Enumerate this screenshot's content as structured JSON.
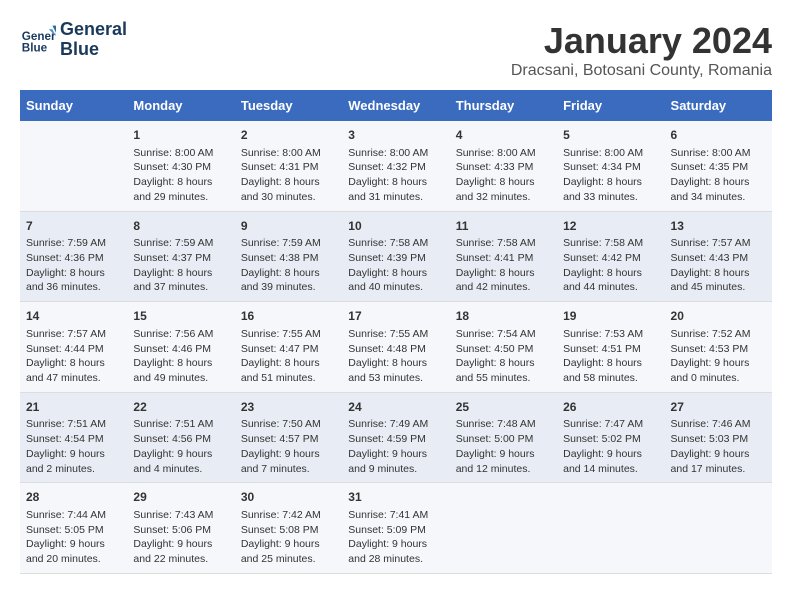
{
  "header": {
    "logo_line1": "General",
    "logo_line2": "Blue",
    "title": "January 2024",
    "subtitle": "Dracsani, Botosani County, Romania"
  },
  "days": [
    "Sunday",
    "Monday",
    "Tuesday",
    "Wednesday",
    "Thursday",
    "Friday",
    "Saturday"
  ],
  "weeks": [
    [
      {
        "date": "",
        "sunrise": "",
        "sunset": "",
        "daylight": ""
      },
      {
        "date": "1",
        "sunrise": "Sunrise: 8:00 AM",
        "sunset": "Sunset: 4:30 PM",
        "daylight": "Daylight: 8 hours and 29 minutes."
      },
      {
        "date": "2",
        "sunrise": "Sunrise: 8:00 AM",
        "sunset": "Sunset: 4:31 PM",
        "daylight": "Daylight: 8 hours and 30 minutes."
      },
      {
        "date": "3",
        "sunrise": "Sunrise: 8:00 AM",
        "sunset": "Sunset: 4:32 PM",
        "daylight": "Daylight: 8 hours and 31 minutes."
      },
      {
        "date": "4",
        "sunrise": "Sunrise: 8:00 AM",
        "sunset": "Sunset: 4:33 PM",
        "daylight": "Daylight: 8 hours and 32 minutes."
      },
      {
        "date": "5",
        "sunrise": "Sunrise: 8:00 AM",
        "sunset": "Sunset: 4:34 PM",
        "daylight": "Daylight: 8 hours and 33 minutes."
      },
      {
        "date": "6",
        "sunrise": "Sunrise: 8:00 AM",
        "sunset": "Sunset: 4:35 PM",
        "daylight": "Daylight: 8 hours and 34 minutes."
      }
    ],
    [
      {
        "date": "7",
        "sunrise": "Sunrise: 7:59 AM",
        "sunset": "Sunset: 4:36 PM",
        "daylight": "Daylight: 8 hours and 36 minutes."
      },
      {
        "date": "8",
        "sunrise": "Sunrise: 7:59 AM",
        "sunset": "Sunset: 4:37 PM",
        "daylight": "Daylight: 8 hours and 37 minutes."
      },
      {
        "date": "9",
        "sunrise": "Sunrise: 7:59 AM",
        "sunset": "Sunset: 4:38 PM",
        "daylight": "Daylight: 8 hours and 39 minutes."
      },
      {
        "date": "10",
        "sunrise": "Sunrise: 7:58 AM",
        "sunset": "Sunset: 4:39 PM",
        "daylight": "Daylight: 8 hours and 40 minutes."
      },
      {
        "date": "11",
        "sunrise": "Sunrise: 7:58 AM",
        "sunset": "Sunset: 4:41 PM",
        "daylight": "Daylight: 8 hours and 42 minutes."
      },
      {
        "date": "12",
        "sunrise": "Sunrise: 7:58 AM",
        "sunset": "Sunset: 4:42 PM",
        "daylight": "Daylight: 8 hours and 44 minutes."
      },
      {
        "date": "13",
        "sunrise": "Sunrise: 7:57 AM",
        "sunset": "Sunset: 4:43 PM",
        "daylight": "Daylight: 8 hours and 45 minutes."
      }
    ],
    [
      {
        "date": "14",
        "sunrise": "Sunrise: 7:57 AM",
        "sunset": "Sunset: 4:44 PM",
        "daylight": "Daylight: 8 hours and 47 minutes."
      },
      {
        "date": "15",
        "sunrise": "Sunrise: 7:56 AM",
        "sunset": "Sunset: 4:46 PM",
        "daylight": "Daylight: 8 hours and 49 minutes."
      },
      {
        "date": "16",
        "sunrise": "Sunrise: 7:55 AM",
        "sunset": "Sunset: 4:47 PM",
        "daylight": "Daylight: 8 hours and 51 minutes."
      },
      {
        "date": "17",
        "sunrise": "Sunrise: 7:55 AM",
        "sunset": "Sunset: 4:48 PM",
        "daylight": "Daylight: 8 hours and 53 minutes."
      },
      {
        "date": "18",
        "sunrise": "Sunrise: 7:54 AM",
        "sunset": "Sunset: 4:50 PM",
        "daylight": "Daylight: 8 hours and 55 minutes."
      },
      {
        "date": "19",
        "sunrise": "Sunrise: 7:53 AM",
        "sunset": "Sunset: 4:51 PM",
        "daylight": "Daylight: 8 hours and 58 minutes."
      },
      {
        "date": "20",
        "sunrise": "Sunrise: 7:52 AM",
        "sunset": "Sunset: 4:53 PM",
        "daylight": "Daylight: 9 hours and 0 minutes."
      }
    ],
    [
      {
        "date": "21",
        "sunrise": "Sunrise: 7:51 AM",
        "sunset": "Sunset: 4:54 PM",
        "daylight": "Daylight: 9 hours and 2 minutes."
      },
      {
        "date": "22",
        "sunrise": "Sunrise: 7:51 AM",
        "sunset": "Sunset: 4:56 PM",
        "daylight": "Daylight: 9 hours and 4 minutes."
      },
      {
        "date": "23",
        "sunrise": "Sunrise: 7:50 AM",
        "sunset": "Sunset: 4:57 PM",
        "daylight": "Daylight: 9 hours and 7 minutes."
      },
      {
        "date": "24",
        "sunrise": "Sunrise: 7:49 AM",
        "sunset": "Sunset: 4:59 PM",
        "daylight": "Daylight: 9 hours and 9 minutes."
      },
      {
        "date": "25",
        "sunrise": "Sunrise: 7:48 AM",
        "sunset": "Sunset: 5:00 PM",
        "daylight": "Daylight: 9 hours and 12 minutes."
      },
      {
        "date": "26",
        "sunrise": "Sunrise: 7:47 AM",
        "sunset": "Sunset: 5:02 PM",
        "daylight": "Daylight: 9 hours and 14 minutes."
      },
      {
        "date": "27",
        "sunrise": "Sunrise: 7:46 AM",
        "sunset": "Sunset: 5:03 PM",
        "daylight": "Daylight: 9 hours and 17 minutes."
      }
    ],
    [
      {
        "date": "28",
        "sunrise": "Sunrise: 7:44 AM",
        "sunset": "Sunset: 5:05 PM",
        "daylight": "Daylight: 9 hours and 20 minutes."
      },
      {
        "date": "29",
        "sunrise": "Sunrise: 7:43 AM",
        "sunset": "Sunset: 5:06 PM",
        "daylight": "Daylight: 9 hours and 22 minutes."
      },
      {
        "date": "30",
        "sunrise": "Sunrise: 7:42 AM",
        "sunset": "Sunset: 5:08 PM",
        "daylight": "Daylight: 9 hours and 25 minutes."
      },
      {
        "date": "31",
        "sunrise": "Sunrise: 7:41 AM",
        "sunset": "Sunset: 5:09 PM",
        "daylight": "Daylight: 9 hours and 28 minutes."
      },
      {
        "date": "",
        "sunrise": "",
        "sunset": "",
        "daylight": ""
      },
      {
        "date": "",
        "sunrise": "",
        "sunset": "",
        "daylight": ""
      },
      {
        "date": "",
        "sunrise": "",
        "sunset": "",
        "daylight": ""
      }
    ]
  ]
}
